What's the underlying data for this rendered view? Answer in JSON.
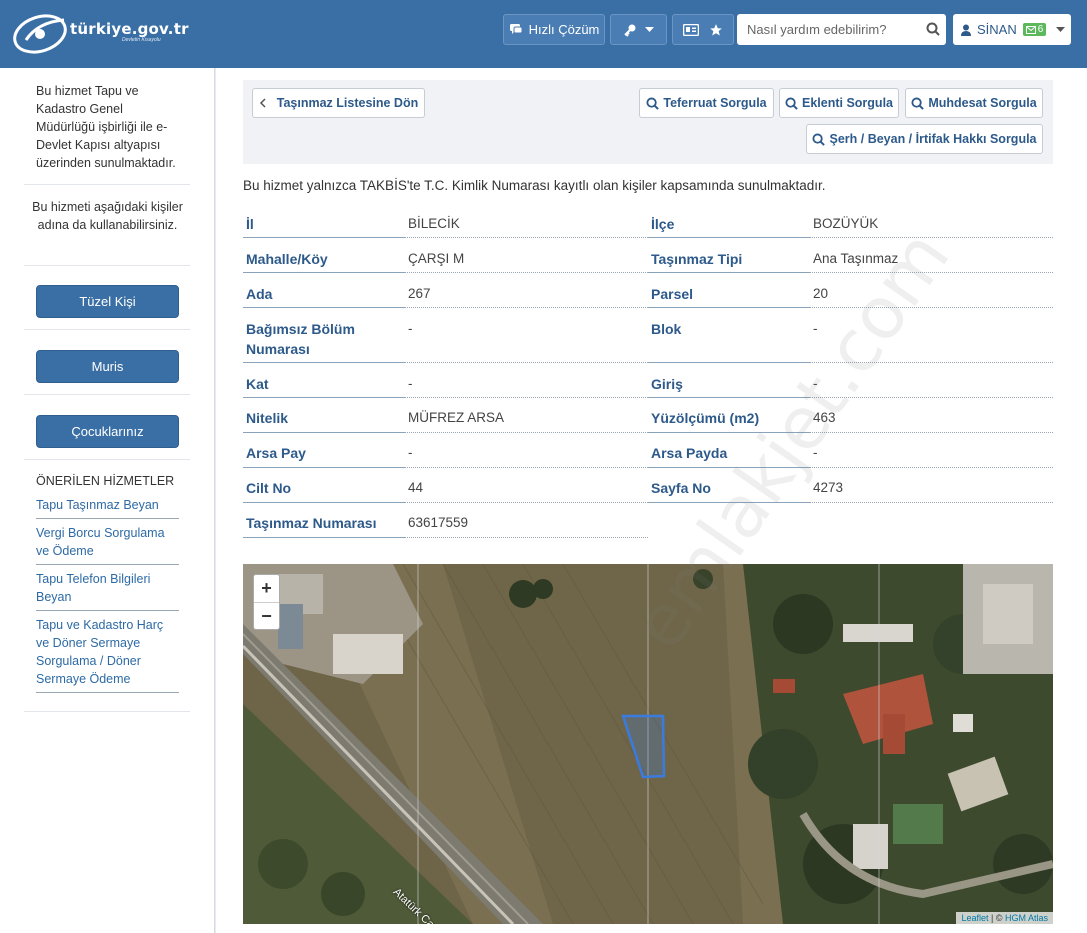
{
  "header": {
    "logo_text": "türkiye.gov.tr",
    "logo_tagline": "Devletin Kısayolu",
    "quick_solution_label": "Hızlı Çözüm",
    "search_placeholder": "Nasıl yardım edebilirim?",
    "user_name": "SİNAN",
    "message_count": "6",
    "icons": [
      "chat-icon",
      "key-icon",
      "id-card-icon",
      "star-icon",
      "search-icon",
      "user-icon",
      "mail-icon"
    ]
  },
  "sidebar": {
    "intro": "Bu hizmet Tapu ve Kadastro Genel Müdürlüğü işbirliği ile e-Devlet Kapısı altyapısı üzerinden sunulmaktadır.",
    "note": "Bu hizmeti aşağıdaki kişiler adına da kullanabilirsiniz.",
    "buttons": [
      "Tüzel Kişi",
      "Muris",
      "Çocuklarınız"
    ],
    "suggested_heading": "ÖNERİLEN HİZMETLER",
    "suggested": [
      "Tapu Taşınmaz Beyan",
      "Vergi Borcu Sorgulama ve Ödeme",
      "Tapu Telefon Bilgileri Beyan",
      "Tapu ve Kadastro Harç ve Döner Sermaye Sorgulama / Döner Sermaye Ödeme"
    ]
  },
  "toolbar": {
    "back": "Taşınmaz Listesine Dön",
    "detail": "Teferruat Sorgula",
    "annex": "Eklenti Sorgula",
    "structure": "Muhdesat Sorgula",
    "annotation": "Şerh / Beyan / İrtifak Hakkı Sorgula"
  },
  "info_text": "Bu hizmet yalnızca TAKBİS'te T.C. Kimlik Numarası kayıtlı olan kişiler kapsamında sunulmaktadır.",
  "property": {
    "il_label": "İl",
    "il_value": "BİLECİK",
    "ilce_label": "İlçe",
    "ilce_value": "BOZÜYÜK",
    "mahalle_label": "Mahalle/Köy",
    "mahalle_value": "ÇARŞI M",
    "tip_label": "Taşınmaz Tipi",
    "tip_value": "Ana Taşınmaz",
    "ada_label": "Ada",
    "ada_value": "267",
    "parsel_label": "Parsel",
    "parsel_value": "20",
    "bolum_label": "Bağımsız Bölüm Numarası",
    "bolum_value": "-",
    "blok_label": "Blok",
    "blok_value": "-",
    "kat_label": "Kat",
    "kat_value": "-",
    "giris_label": "Giriş",
    "giris_value": "-",
    "nitelik_label": "Nitelik",
    "nitelik_value": "MÜFREZ ARSA",
    "yuzolcum_label": "Yüzölçümü (m2)",
    "yuzolcum_value": "463",
    "arsapay_label": "Arsa Pay",
    "arsapay_value": "-",
    "arsapayda_label": "Arsa Payda",
    "arsapayda_value": "-",
    "cilt_label": "Cilt No",
    "cilt_value": "44",
    "sayfa_label": "Sayfa No",
    "sayfa_value": "4273",
    "tasinmaz_label": "Taşınmaz Numarası",
    "tasinmaz_value": "63617559"
  },
  "map": {
    "zoom_in": "+",
    "zoom_out": "−",
    "road_label": "Atatürk Cad",
    "attribution_leaflet": "Leaflet",
    "attribution_sep": " | © ",
    "attribution_source": "HGM Atlas"
  },
  "watermark": "emlakjet.com",
  "colors": {
    "header_bg": "#3a6fa5",
    "label_blue": "#2d5a8a",
    "link_blue": "#2d6aa5",
    "parcel_outline": "#3a7be0"
  }
}
